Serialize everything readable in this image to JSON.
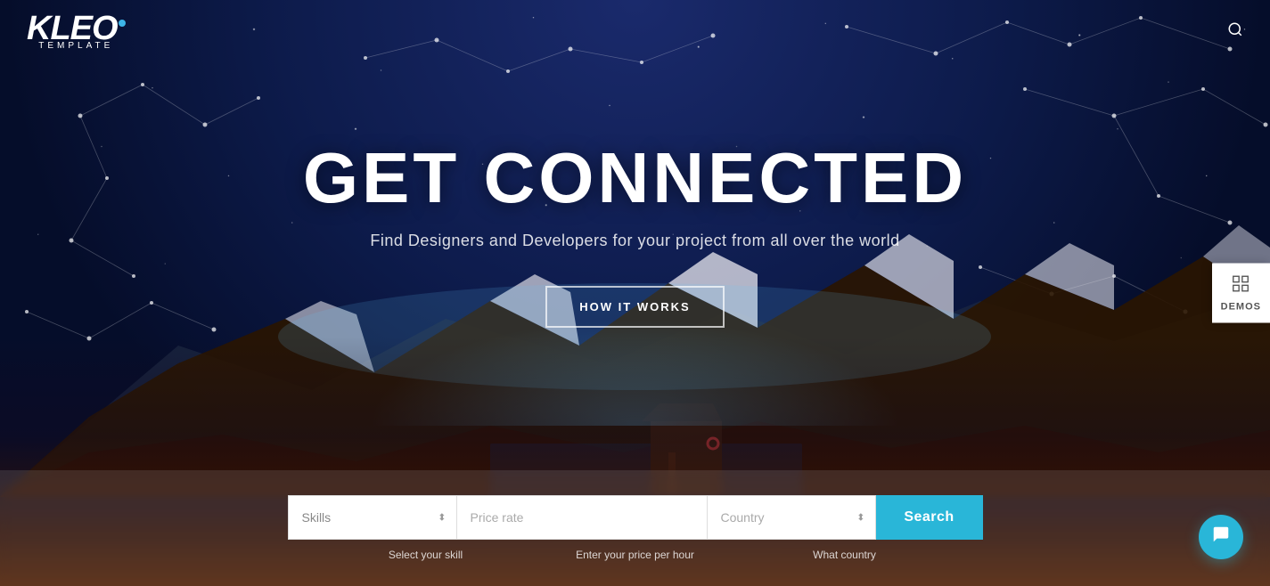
{
  "logo": {
    "brand": "KLEO",
    "tagline": "TEMPLATE",
    "dot_color": "#3db5e8"
  },
  "nav": {
    "search_icon": "🔍"
  },
  "hero": {
    "title": "GET CONNECTED",
    "subtitle": "Find Designers and Developers for your project from all over the world",
    "cta_button": "HOW IT WORKS"
  },
  "search": {
    "skills_placeholder": "Skills",
    "price_placeholder": "Price rate",
    "country_placeholder": "Country",
    "search_button": "Search",
    "label_skill": "Select your skill",
    "label_price": "Enter your price per hour",
    "label_country": "What country"
  },
  "demos": {
    "label": "DEMOS",
    "icon": "⊞"
  },
  "chat": {
    "icon": "💬"
  }
}
